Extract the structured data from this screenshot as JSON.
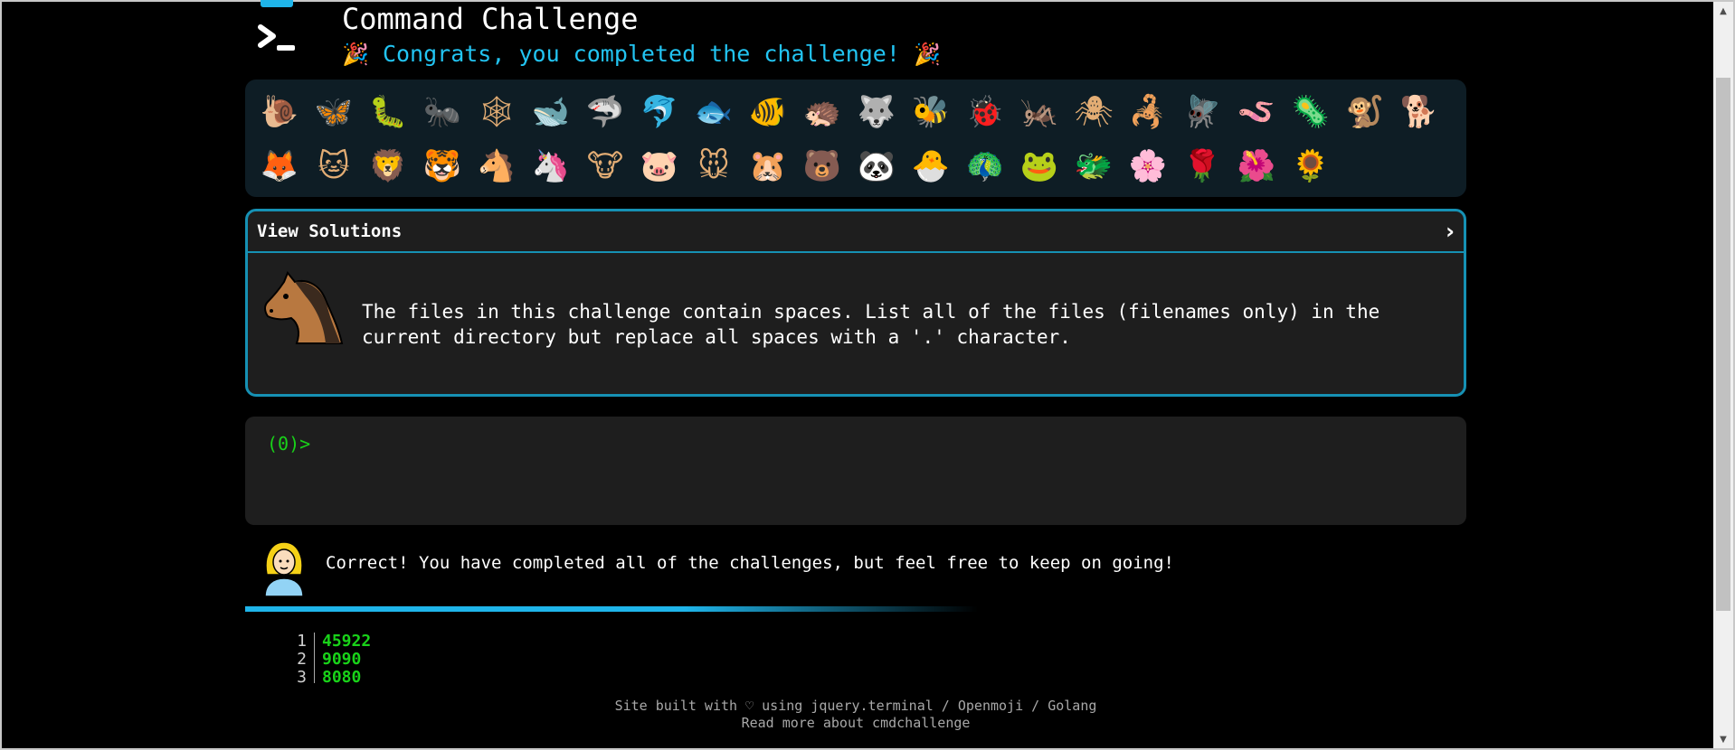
{
  "header": {
    "title": "Command Challenge",
    "subtitle": "Congrats, you completed the challenge!",
    "party_emoji": "🎉"
  },
  "emoji_grid": {
    "items": [
      "🐌",
      "🦋",
      "🐛",
      "🐜",
      "🕸",
      "🐋",
      "🦈",
      "🐬",
      "🐟",
      "🐠",
      "🦔",
      "🐺",
      "🐝",
      "🐞",
      "🦗",
      "🕷",
      "🦂",
      "🪰",
      "🪱",
      "🦠",
      "🐒",
      "🐕",
      "🦊",
      "🐱",
      "🦁",
      "🐯",
      "🐴",
      "🦄",
      "🐮",
      "🐷",
      "🐭",
      "🐹",
      "🐻",
      "🐼",
      "🐣",
      "🦚",
      "🐸",
      "🐲",
      "🌸",
      "🌹",
      "🌺",
      "🌻"
    ]
  },
  "solutions": {
    "label": "View Solutions",
    "chevron": "›",
    "challenge_text": "The files in this challenge contain spaces. List all of the files (filenames only) in the current directory but replace all spaces with a '.' character."
  },
  "terminal": {
    "prompt": "(0)>"
  },
  "result": {
    "message": "Correct! You have completed all of the challenges, but feel free to keep on going!",
    "progress": 0.6
  },
  "output": {
    "lines": [
      {
        "no": "1",
        "value": "45922"
      },
      {
        "no": "2",
        "value": "9090"
      },
      {
        "no": "3",
        "value": "8080"
      }
    ]
  },
  "footer": {
    "line1": "Site built with ♡ using jquery.terminal / Openmoji / Golang",
    "line2": "Read more about cmdchallenge"
  },
  "scrollbar": {
    "up": "▲",
    "down": "▼"
  },
  "colors": {
    "accent": "#1fb5ea",
    "prompt": "#19d219",
    "panel": "#1e1e1e",
    "border": "#1691b4"
  }
}
